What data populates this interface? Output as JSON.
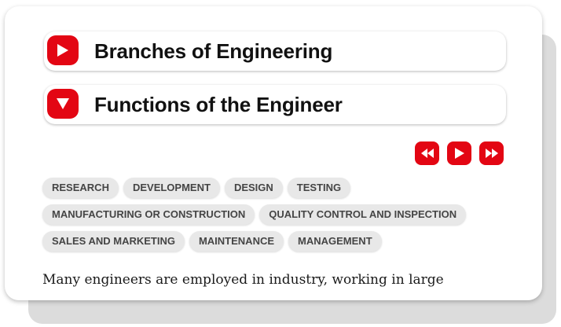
{
  "accordions": [
    {
      "title": "Branches of Engineering",
      "state_icon": "play-right-icon"
    },
    {
      "title": "Functions of the Engineer",
      "state_icon": "triangle-down-icon"
    }
  ],
  "navigation": {
    "icons": [
      "rewind-icon",
      "play-icon",
      "fast-forward-icon"
    ],
    "accent_color": "#e30613"
  },
  "tags": [
    [
      "RESEARCH",
      "DEVELOPMENT",
      "DESIGN",
      "TESTING"
    ],
    [
      "MANUFACTURING OR CONSTRUCTION",
      "QUALITY CONTROL AND INSPECTION"
    ],
    [
      "SALES AND MARKETING",
      "MAINTENANCE",
      "MANAGEMENT"
    ]
  ],
  "body_text": "Many engineers are employed in industry, working in large"
}
